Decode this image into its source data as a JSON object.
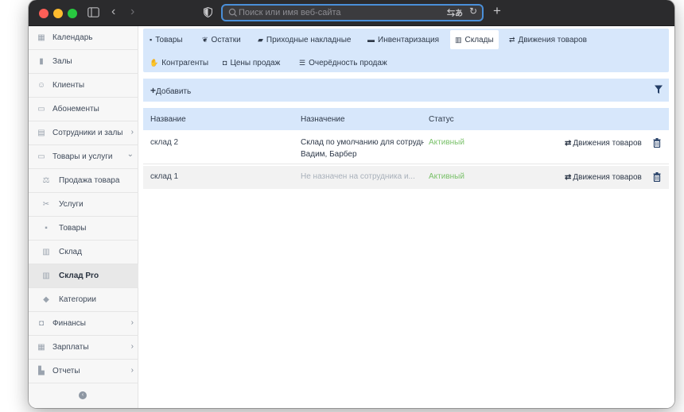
{
  "browser": {
    "search_placeholder": "Поиск или имя веб-сайта",
    "colors": {
      "close": "#fe5f57",
      "minimize": "#febc2e",
      "zoom": "#28c840",
      "focus_ring": "#4a8fd9"
    },
    "icons": [
      "sidebar-toggle-icon",
      "back-icon",
      "forward-icon",
      "shield-icon",
      "search-icon",
      "translate-icon",
      "reload-icon",
      "new-tab-icon"
    ]
  },
  "sidebar": {
    "items": [
      {
        "label": "Календарь",
        "icon": "calendar-icon",
        "glyph": "▦"
      },
      {
        "label": "Залы",
        "icon": "bookmark-icon",
        "glyph": "▮"
      },
      {
        "label": "Клиенты",
        "icon": "users-icon",
        "glyph": "☺"
      },
      {
        "label": "Абонементы",
        "icon": "card-icon",
        "glyph": "▭"
      },
      {
        "label": "Сотрудники и залы",
        "icon": "id-card-icon",
        "glyph": "▤",
        "chevron": "›"
      },
      {
        "label": "Товары и услуги",
        "icon": "card-icon",
        "glyph": "▭",
        "chevron": "⌄"
      },
      {
        "label": "Продажа товара",
        "icon": "scale-icon",
        "glyph": "⚖"
      },
      {
        "label": "Услуги",
        "icon": "scissors-icon",
        "glyph": "✂"
      },
      {
        "label": "Товары",
        "icon": "tag-icon",
        "glyph": "▪"
      },
      {
        "label": "Склад",
        "icon": "warehouse-icon",
        "glyph": "▥"
      },
      {
        "label": "Склад Pro",
        "icon": "warehouse-icon",
        "glyph": "▥"
      },
      {
        "label": "Категории",
        "icon": "tags-icon",
        "glyph": "◆"
      },
      {
        "label": "Финансы",
        "icon": "money-icon",
        "glyph": "◘",
        "chevron": "›"
      },
      {
        "label": "Зарплаты",
        "icon": "calculator-icon",
        "glyph": "▦",
        "chevron": "›"
      },
      {
        "label": "Отчеты",
        "icon": "bar-chart-icon",
        "glyph": "▙",
        "chevron": "›"
      }
    ],
    "collapse_glyph": "‹"
  },
  "tabs": [
    {
      "label": "Товары",
      "icon": "tag-icon",
      "glyph": "▪"
    },
    {
      "label": "Остатки",
      "icon": "leaf-icon",
      "glyph": "❦"
    },
    {
      "label": "Приходные накладные",
      "icon": "folder-open-icon",
      "glyph": "▰"
    },
    {
      "label": "Инвентаризация",
      "icon": "folder-icon",
      "glyph": "▬"
    },
    {
      "label": "Склады",
      "icon": "warehouse-icon",
      "glyph": "▥",
      "active": true
    },
    {
      "label": "Движения товаров",
      "icon": "exchange-icon",
      "glyph": "⇄"
    },
    {
      "label": "Контрагенты",
      "icon": "handshake-icon",
      "glyph": "✋"
    },
    {
      "label": "Цены продаж",
      "icon": "money-icon",
      "glyph": "◘"
    },
    {
      "label": "Очерёдность продаж",
      "icon": "list-icon",
      "glyph": "☰"
    }
  ],
  "toolbar": {
    "add_label": "Добавить",
    "add_glyph": "+"
  },
  "table": {
    "columns": [
      "Название",
      "Назначение",
      "Статус"
    ],
    "rows": [
      {
        "name": "склад 2",
        "purpose_line1": "Склад по умолчанию для сотрудн",
        "purpose_line2": "Вадим, Барбер",
        "status": "Активный",
        "action": "Движения товаров"
      },
      {
        "name": "склад 1",
        "purpose_line1": "Не назначен на сотрудника и...",
        "status": "Активный",
        "action": "Движения товаров"
      }
    ]
  }
}
